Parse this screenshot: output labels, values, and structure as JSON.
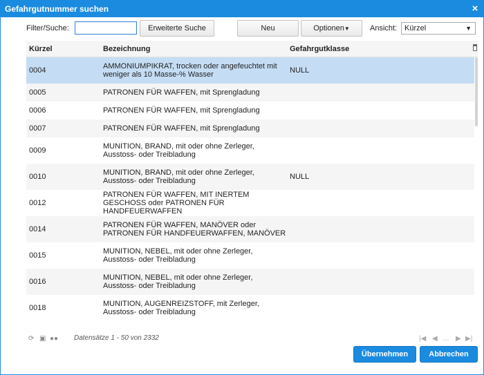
{
  "window": {
    "title": "Gefahrgutnummer suchen",
    "close_glyph": "×"
  },
  "toolbar": {
    "filter_label": "Filter/Suche:",
    "filter_value": "",
    "advanced_search_label": "Erweiterte Suche",
    "new_label": "Neu",
    "options_label": "Optionen",
    "view_label": "Ansicht:",
    "view_selected": "Kürzel"
  },
  "grid": {
    "columns": [
      "Kürzel",
      "Bezeichnung",
      "Gefahrgutklasse"
    ],
    "rows": [
      {
        "code": "0004",
        "name": "AMMONIUMPIKRAT, trocken oder angefeuchtet mit weniger als 10 Masse-% Wasser",
        "class": "NULL",
        "selected": true
      },
      {
        "code": "0005",
        "name": "PATRONEN FÜR WAFFEN, mit Sprengladung",
        "class": ""
      },
      {
        "code": "0006",
        "name": "PATRONEN FÜR WAFFEN, mit Sprengladung",
        "class": ""
      },
      {
        "code": "0007",
        "name": "PATRONEN FÜR WAFFEN, mit Sprengladung",
        "class": ""
      },
      {
        "code": "0009",
        "name": "MUNITION, BRAND, mit oder ohne Zerleger, Ausstoss- oder Treibladung",
        "class": ""
      },
      {
        "code": "0010",
        "name": "MUNITION, BRAND, mit oder ohne Zerleger, Ausstoss- oder Treibladung",
        "class": "NULL"
      },
      {
        "code": "0012",
        "name": "PATRONEN FÜR WAFFEN, MIT INERTEM GESCHOSS oder PATRONEN FÜR HANDFEUERWAFFEN",
        "class": ""
      },
      {
        "code": "0014",
        "name": "PATRONEN FÜR WAFFEN, MANÖVER oder PATRONEN FÜR HANDFEUERWAFFEN, MANÖVER",
        "class": ""
      },
      {
        "code": "0015",
        "name": "MUNITION, NEBEL, mit oder ohne Zerleger, Ausstoss- oder Treibladung",
        "class": ""
      },
      {
        "code": "0016",
        "name": "MUNITION, NEBEL, mit oder ohne Zerleger, Ausstoss- oder Treibladung",
        "class": ""
      },
      {
        "code": "0018",
        "name": "MUNITION, AUGENREIZSTOFF, mit Zerleger, Ausstoss- oder Treibladung",
        "class": ""
      }
    ]
  },
  "pager": {
    "info": "Datensätze 1 - 50 von 2332",
    "icons": [
      "refresh-icon",
      "print-icon",
      "export-icon"
    ],
    "nav": [
      "|◀",
      "◀",
      "...",
      "▶",
      "▶|"
    ]
  },
  "footer": {
    "apply_label": "Übernehmen",
    "cancel_label": "Abbrechen"
  },
  "colors": {
    "accent": "#1b8be0",
    "selected_row": "#c5ddf4",
    "alt_row": "#f5f5f5"
  }
}
